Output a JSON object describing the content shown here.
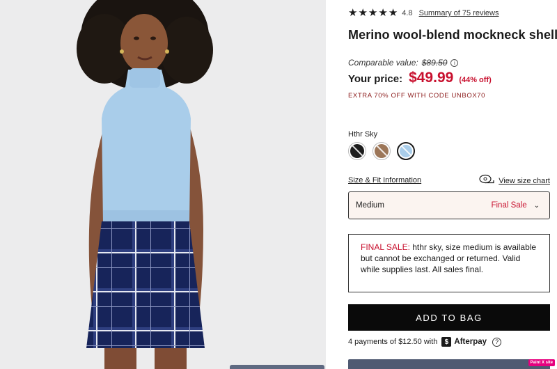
{
  "product": {
    "rating": "4.8",
    "stars_filled": 5,
    "reviews_link": "Summary of 75 reviews",
    "title": "Merino wool-blend mockneck shell"
  },
  "pricing": {
    "comparable_label": "Comparable value:",
    "comparable_price": "$89.50",
    "price_label": "Your price:",
    "price": "$49.99",
    "discount": "(44% off)",
    "promo": "EXTRA 70% OFF WITH CODE UNBOX70"
  },
  "color": {
    "selected_name": "Hthr Sky",
    "swatches": [
      {
        "name": "black",
        "hex": "#1c1c1c"
      },
      {
        "name": "camel",
        "hex": "#9c7658"
      },
      {
        "name": "hthr-sky",
        "hex": "#a9cdea"
      }
    ]
  },
  "size": {
    "fit_link": "Size & Fit Information",
    "chart_link": "View size chart",
    "selected": "Medium",
    "status": "Final Sale"
  },
  "final_sale_notice": {
    "lead": "FINAL SALE:",
    "body": " hthr sky, size medium is available but cannot be exchanged or returned. Valid while supplies last. All sales final."
  },
  "cta": {
    "add_to_bag": "ADD TO BAG",
    "afterpay_text": "4 payments of $12.50 with",
    "afterpay_brand": "Afterpay",
    "afterpay_badge": "$"
  },
  "overlay": {
    "badge": "Paint X site"
  },
  "colors": {
    "price_red": "#c8102e",
    "promo_red": "#8b1a1a",
    "button_black": "#0a0a0a",
    "select_bg": "#fbf4f0"
  },
  "icons": [
    "star-icon",
    "info-icon",
    "tape-measure-icon",
    "chevron-down-icon",
    "afterpay-icon",
    "help-icon"
  ]
}
